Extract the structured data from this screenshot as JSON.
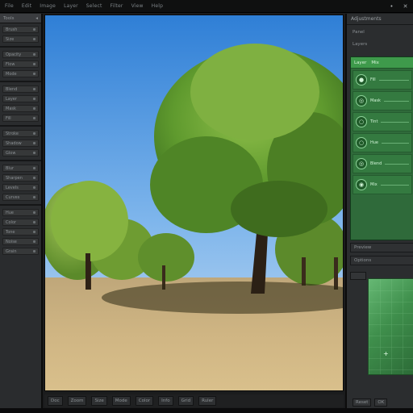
{
  "menubar": {
    "items": [
      "File",
      "Edit",
      "Image",
      "Layer",
      "Select",
      "Filter",
      "View",
      "Help"
    ],
    "window_buttons": [
      "•",
      "✕"
    ]
  },
  "left_panel": {
    "header": "Tools",
    "rows": [
      "Brush",
      "Size",
      "Opacity",
      "Flow",
      "Mode",
      "Blend",
      "Layer",
      "Mask",
      "Fill",
      "Stroke",
      "Shadow",
      "Glow",
      "Blur",
      "Sharpen",
      "Levels",
      "Curves",
      "Hue",
      "Color",
      "Tone",
      "Noise",
      "Grain"
    ]
  },
  "bottombar": {
    "items": [
      "Doc",
      "Zoom",
      "Size",
      "Mode",
      "Color",
      "Info",
      "Grid",
      "Ruler"
    ]
  },
  "right_panel": {
    "title": "Adjustments",
    "tabs": [
      "Panel",
      "Layers"
    ],
    "green_header": [
      "Layer",
      "Mix"
    ],
    "green_rows": [
      "Fill",
      "Mask",
      "Tint",
      "Hue",
      "Blend",
      "Mix"
    ],
    "sections": [
      "Preview",
      "Options"
    ],
    "footer": [
      "Reset",
      "OK"
    ]
  },
  "colors": {
    "accent_green": "#3e9a4b",
    "panel_bg": "#2b2d2f",
    "canvas_sky": "#2f7fd6"
  }
}
